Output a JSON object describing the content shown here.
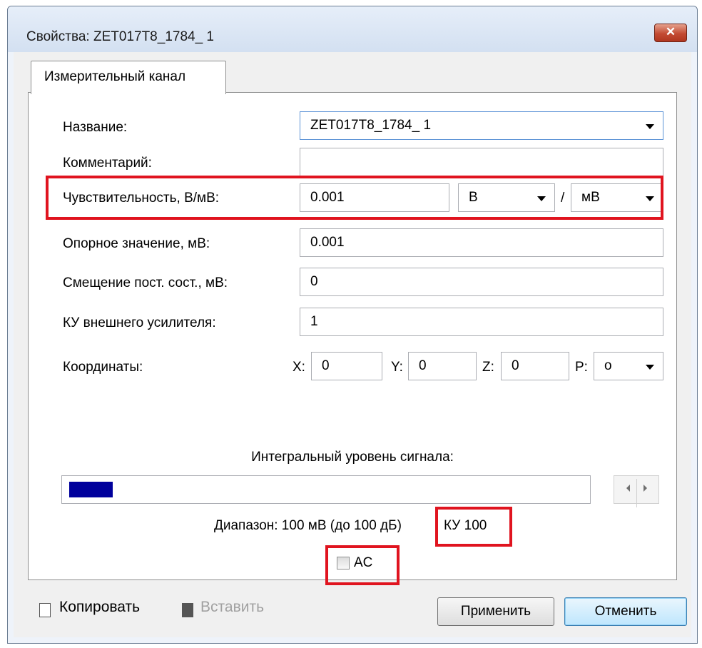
{
  "window": {
    "title": "Свойства: ZET017T8_1784_ 1",
    "close_glyph": "✕"
  },
  "tab": {
    "label": "Измерительный канал"
  },
  "form": {
    "name_label": "Название:",
    "name_value": "ZET017T8_1784_ 1",
    "comment_label": "Комментарий:",
    "comment_value": "",
    "sensitivity_label": "Чувствительность, В/мВ:",
    "sensitivity_value": "0.001",
    "sensitivity_unit_num": "В",
    "unit_separator": "/",
    "sensitivity_unit_den": "мВ",
    "reference_label": "Опорное значение, мВ:",
    "reference_value": "0.001",
    "offset_label": "Смещение пост. сост., мВ:",
    "offset_value": "0",
    "gain_label": "КУ внешнего усилителя:",
    "gain_value": "1",
    "coords_label": "Координаты:",
    "x_label": "X:",
    "x_value": "0",
    "y_label": "Y:",
    "y_value": "0",
    "z_label": "Z:",
    "z_value": "0",
    "p_label": "P:",
    "p_value": "o"
  },
  "signal": {
    "title": "Интегральный уровень сигнала:",
    "level_fraction": 0.085,
    "range_text": "Диапазон: 100 мВ (до 100 дБ)",
    "gain_text": "КУ 100",
    "ac_label": "AC",
    "ac_checked": false
  },
  "footer": {
    "copy_label": "Копировать",
    "paste_label": "Вставить",
    "apply_label": "Применить",
    "cancel_label": "Отменить"
  },
  "colors": {
    "highlight": "#e0141f",
    "meter_fill": "#00009c"
  }
}
